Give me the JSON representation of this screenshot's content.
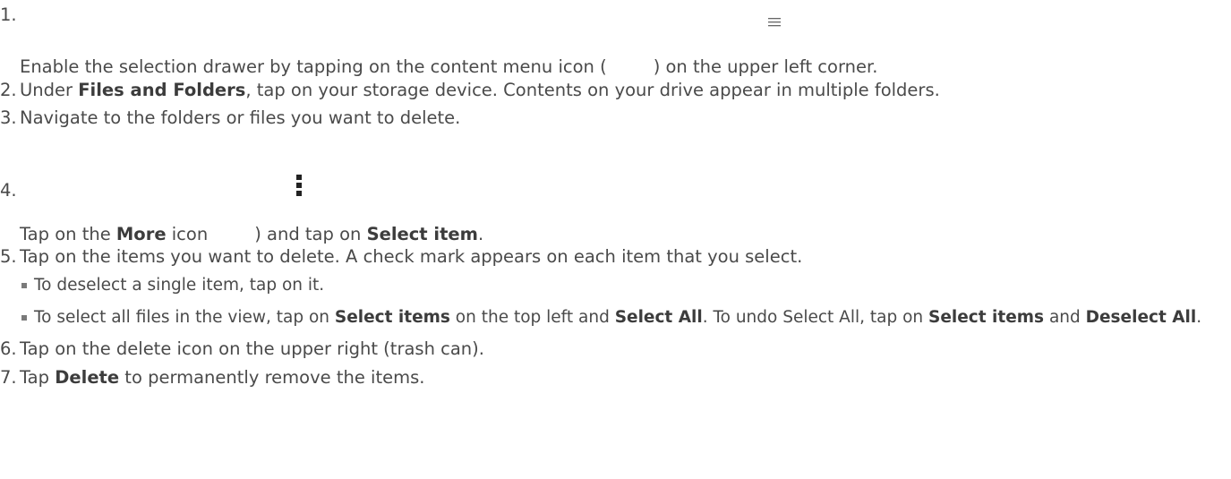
{
  "steps": [
    {
      "num": "1.",
      "pre": "Enable the selection drawer by tapping on the content menu icon (",
      "post": ") on the upper left corner.",
      "icon": "hamburger-menu-icon"
    },
    {
      "num": "2.",
      "pre": "Under ",
      "bold": "Files and Folders",
      "post": ", tap on your storage device. Contents on your drive appear in multiple folders."
    },
    {
      "num": "3.",
      "text": "Navigate to the folders or files you want to delete."
    },
    {
      "num": "4.",
      "pre": "Tap on the ",
      "bold1": "More",
      "mid": " icon",
      "mid2": ") and tap on ",
      "bold2": "Select item",
      "post": ".",
      "icon": "vertical-dots-more-icon"
    },
    {
      "num": "5.",
      "text": "Tap on the items you want to delete. A check mark appears on each item that you select.",
      "subitems": [
        {
          "text": "To deselect a single item, tap on it."
        },
        {
          "pre": "To select all files in the view, tap on ",
          "bold1": "Select items",
          "mid": " on the top left and ",
          "bold2": "Select All",
          "mid2": ". To undo Select All, tap on ",
          "bold3": "Select items",
          "mid3": " and ",
          "bold4": "Deselect All",
          "post": "."
        }
      ]
    },
    {
      "num": "6.",
      "text": "Tap on the delete icon on the upper right (trash can)."
    },
    {
      "num": "7.",
      "pre": "Tap ",
      "bold": "Delete",
      "post": " to permanently remove the items."
    }
  ]
}
